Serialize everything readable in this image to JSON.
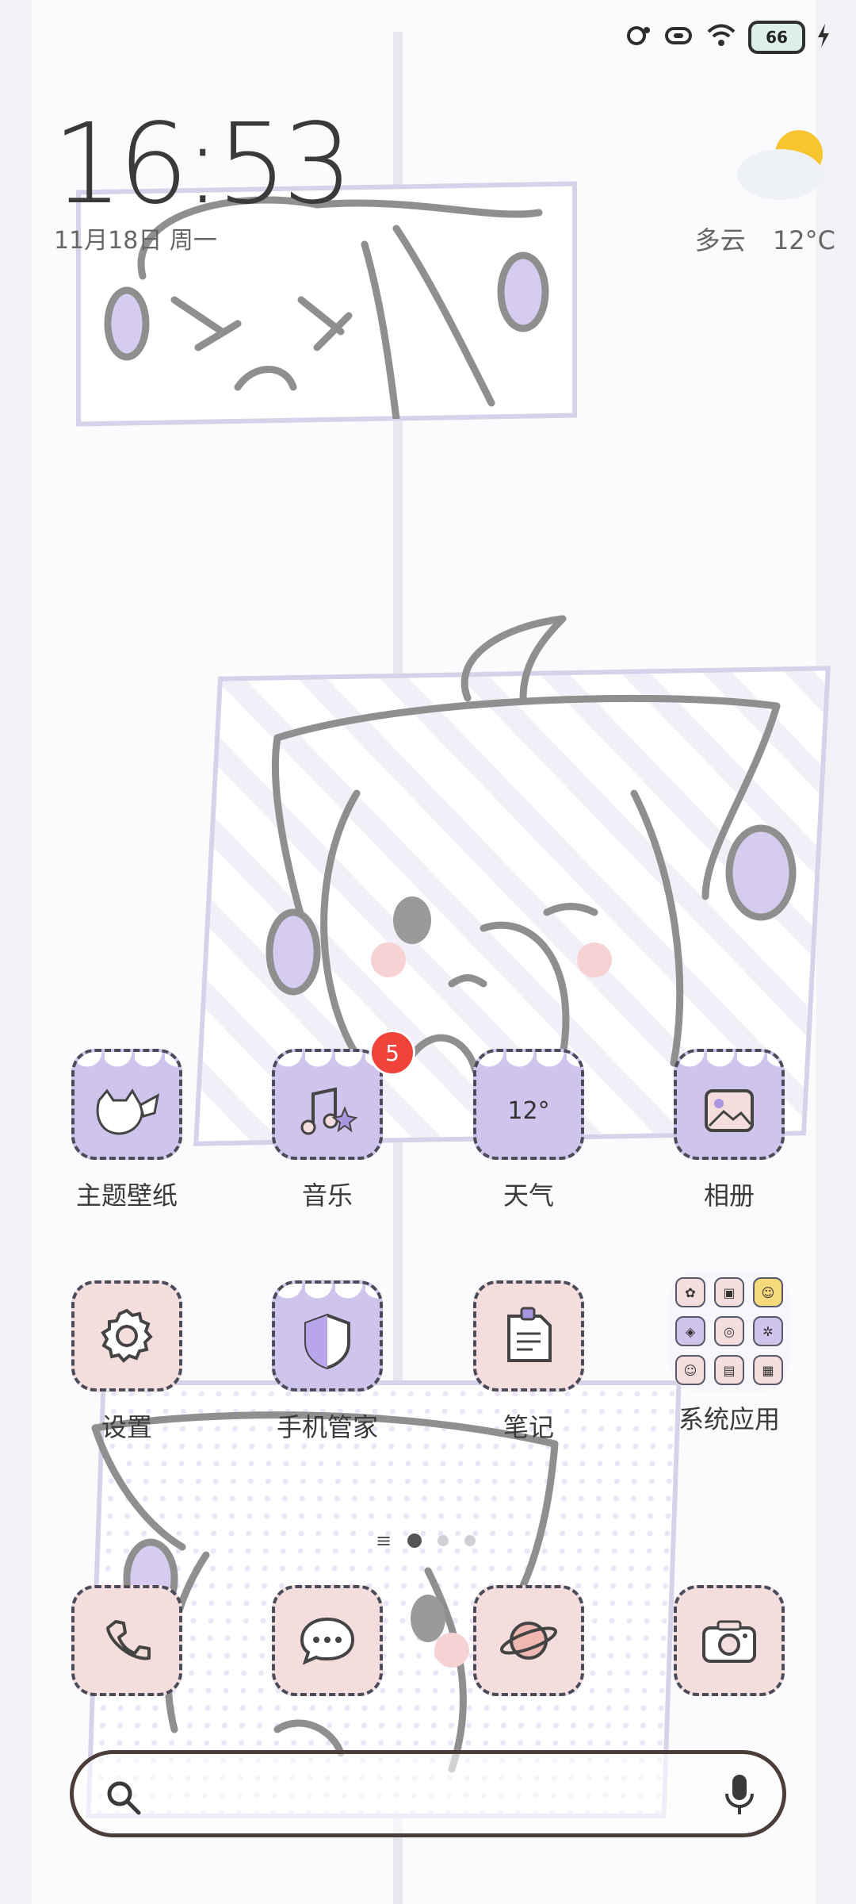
{
  "status_bar": {
    "battery_level": "66",
    "icons": [
      "alarm-icon",
      "vibrate-icon",
      "wifi-icon",
      "battery-icon",
      "charging-icon"
    ]
  },
  "clock": {
    "time": "16:53",
    "date": "11月18日 周一"
  },
  "weather": {
    "condition": "多云",
    "temperature": "12°C",
    "icon": "partly-cloudy-icon"
  },
  "apps": [
    {
      "label": "主题壁纸",
      "icon": "theme-icon"
    },
    {
      "label": "音乐",
      "icon": "music-icon",
      "badge": "5"
    },
    {
      "label": "天气",
      "icon": "weather-icon",
      "icon_text": "12°"
    },
    {
      "label": "相册",
      "icon": "gallery-icon"
    },
    {
      "label": "设置",
      "icon": "settings-icon"
    },
    {
      "label": "手机管家",
      "icon": "security-icon"
    },
    {
      "label": "笔记",
      "icon": "notes-icon"
    },
    {
      "label": "系统应用",
      "icon": "folder-icon"
    }
  ],
  "dock": [
    {
      "icon": "phone-icon"
    },
    {
      "icon": "messages-icon"
    },
    {
      "icon": "browser-icon"
    },
    {
      "icon": "camera-icon"
    }
  ],
  "pager": {
    "pages": 4,
    "current": 1
  },
  "search_bar": {
    "left_icon": "search-icon",
    "right_icon": "microphone-icon"
  },
  "colors": {
    "accent_purple": "#cfc4ec",
    "accent_pink": "#f4dedd",
    "badge_red": "#f0433a",
    "outline": "#4b4b5a"
  }
}
